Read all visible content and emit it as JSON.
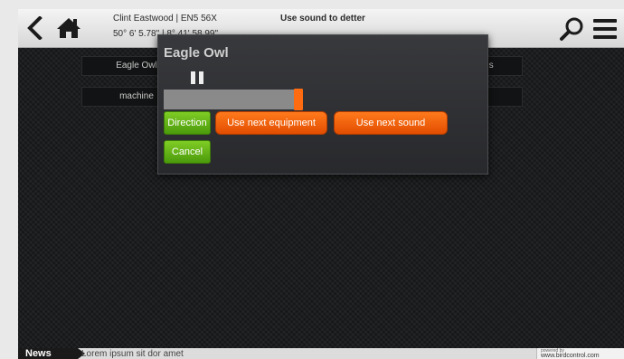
{
  "header": {
    "location_name": "Clint Eastwood | EN5 56X",
    "location_coords": "50° 6' 5.78\" | 8° 41' 58.99\"",
    "title": "Use sound to detter",
    "icons": [
      "chevron-left-icon",
      "home-icon",
      "search-icon",
      "hamburger-menu-icon"
    ]
  },
  "background_buttons": [
    {
      "label": "Eagle Owl"
    },
    {
      "label": "...s"
    },
    {
      "label": "machine"
    }
  ],
  "dialog": {
    "title": "Eagle Owl",
    "progress": 0.97,
    "buttons": {
      "direction": "Direction",
      "next_equipment": "Use next equipment",
      "next_sound": "Use next sound",
      "cancel": "Cancel"
    }
  },
  "news": {
    "label": "News",
    "text": "Lorem ipsum sit dor amet",
    "powered_label": "powered by",
    "powered_url": "www.birdcontrol.com"
  },
  "colors": {
    "accent_orange": "#ff6b10",
    "accent_green": "#6cbf1c",
    "background_dark": "#1c1d1f",
    "header_light": "#e4e4e4"
  }
}
